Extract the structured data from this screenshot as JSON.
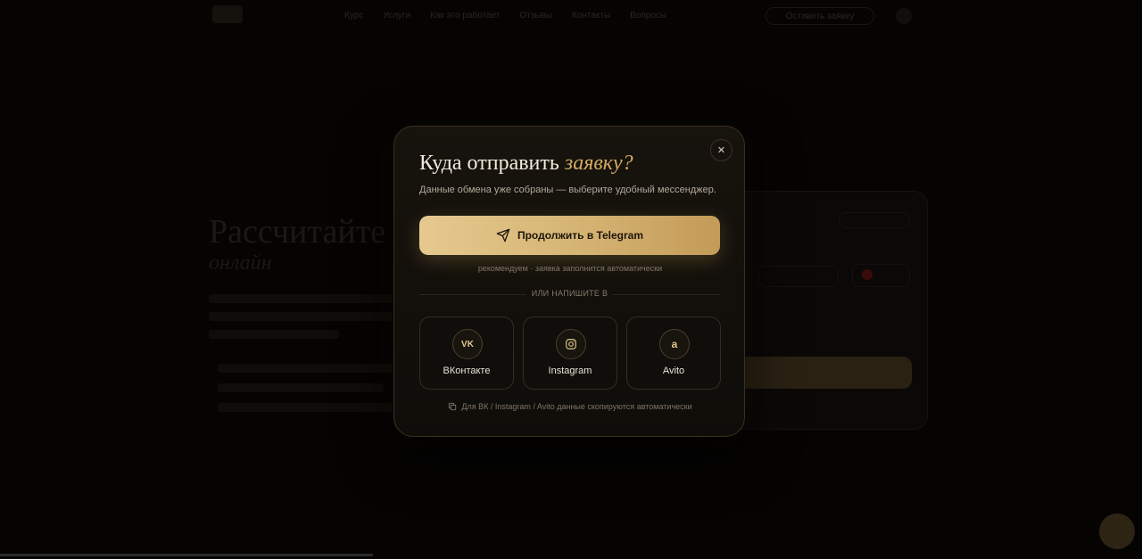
{
  "background": {
    "hero_title": "Рассчитайте о",
    "hero_accent": "онлайн",
    "nav_links": [
      "Курс",
      "Услуги",
      "Как это работает",
      "Отзывы",
      "Контакты",
      "Вопросы"
    ],
    "nav_cta": "Оставить заявку"
  },
  "modal": {
    "close_icon": "✕",
    "title_main": "Куда отправить ",
    "title_accent": "заявку?",
    "subtitle": "Данные обмена уже собраны — выберите удобный мессенджер.",
    "telegram_button": {
      "label": "Продолжить в Telegram",
      "icon": "send-icon"
    },
    "telegram_hint": "рекомендуем · заявка заполнится автоматически",
    "divider_label": "ИЛИ НАПИШИТЕ В",
    "socials": [
      {
        "name": "ВКонтакте",
        "icon_text": "VK",
        "icon": "vk-icon"
      },
      {
        "name": "Instagram",
        "icon_text": "",
        "icon": "instagram-icon"
      },
      {
        "name": "Avito",
        "icon_text": "a",
        "icon": "avito-icon"
      }
    ],
    "footer_note": "Для ВК / Instagram / Avito данные скопируются автоматически",
    "footer_icon": "copy-icon"
  },
  "colors": {
    "accent_gold": "#d2aa63",
    "button_gold_start": "#e5c98f",
    "button_gold_end": "#c49b58",
    "modal_bg": "#15120d"
  }
}
